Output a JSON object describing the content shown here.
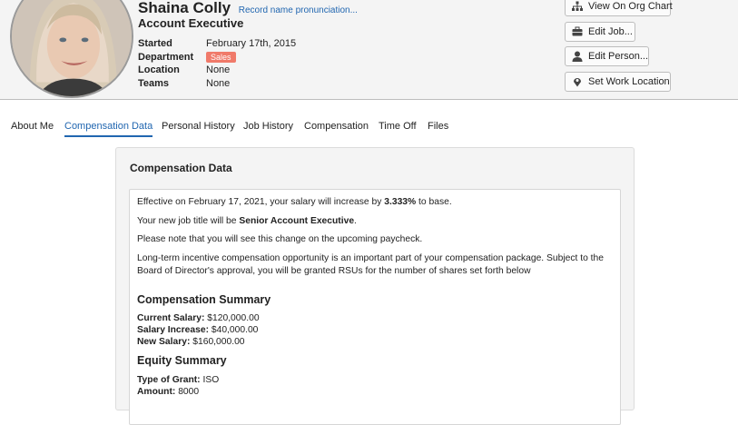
{
  "profile": {
    "name": "Shaina Colly",
    "pronunciation_link": "Record name pronunciation...",
    "job_title": "Account Executive",
    "facts": [
      {
        "label": "Started",
        "value": "February 17th, 2015"
      },
      {
        "label": "Department",
        "value": "Sales"
      },
      {
        "label": "Location",
        "value": "None"
      },
      {
        "label": "Teams",
        "value": "None"
      }
    ]
  },
  "actions": {
    "org_chart": {
      "label": "View On Org Chart",
      "icon": "org-chart-icon"
    },
    "edit_job": {
      "label": "Edit Job...",
      "icon": "briefcase-icon"
    },
    "edit_person": {
      "label": "Edit Person...",
      "icon": "person-icon"
    },
    "work_location": {
      "label": "Set Work Location",
      "icon": "map-pin-icon"
    }
  },
  "tabs": [
    {
      "label": "About Me",
      "active": false
    },
    {
      "label": "Compensation Data",
      "active": true
    },
    {
      "label": "Personal History",
      "active": false
    },
    {
      "label": "Job History",
      "active": false
    },
    {
      "label": "Compensation",
      "active": false
    },
    {
      "label": "Time Off",
      "active": false
    },
    {
      "label": "Files",
      "active": false
    }
  ],
  "panel": {
    "title": "Compensation Data",
    "p1_pre": "Effective on February 17, 2021, your salary will increase by ",
    "p1_bold": "3.333%",
    "p1_post": " to base.",
    "p2_pre": "Your new job title will be ",
    "p2_bold": "Senior Account Executive",
    "p2_post": ".",
    "p3": "Please note that you will see this change on the upcoming paycheck.",
    "p4": "Long-term incentive compensation opportunity is an important part of your compensation package. Subject to the Board of Director's approval, you will be granted RSUs for the number of shares set forth below",
    "comp_heading": "Compensation Summary",
    "current_salary_label": "Current Salary:",
    "current_salary": "$120,000.00",
    "increase_label": "Salary Increase:",
    "increase": "$40,000.00",
    "new_salary_label": "New Salary:",
    "new_salary": "$160,000.00",
    "equity_heading": "Equity Summary",
    "grant_type_label": "Type of Grant:",
    "grant_type": "ISO",
    "amount_label": "Amount:",
    "amount": "8000"
  },
  "colors": {
    "accent": "#2166b0",
    "badge": "#f07a6a"
  }
}
